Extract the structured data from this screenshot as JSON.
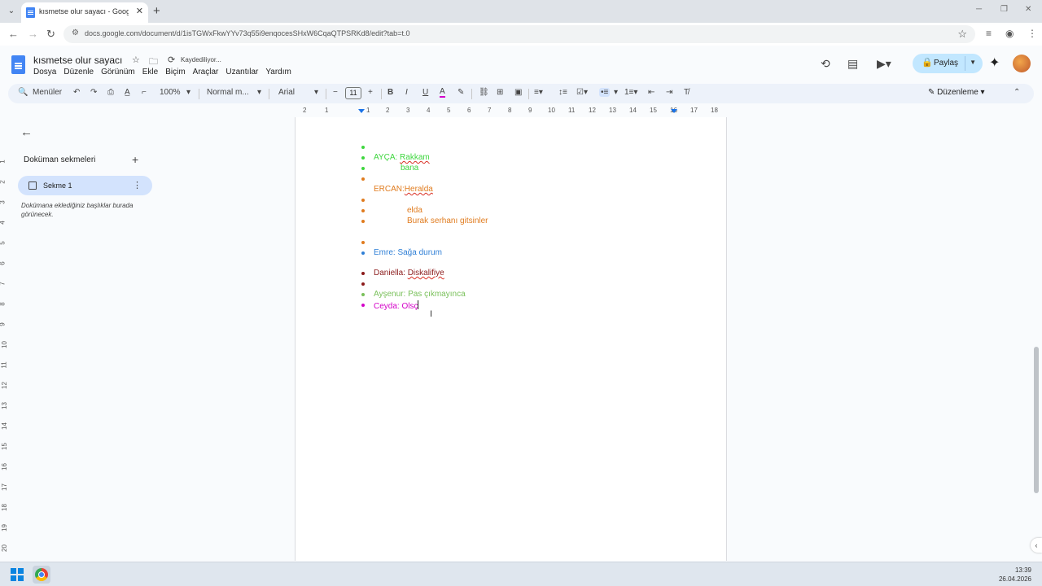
{
  "browser": {
    "tab_title": "kısmetse olur sayacı - Google D",
    "url": "docs.google.com/document/d/1isTGWxFkwYYv73q55i9enqocesSHxW6CqaQTPSRKd8/edit?tab=t.0"
  },
  "docs": {
    "title": "kısmetse olur sayacı",
    "save_status": "Kaydediliyor...",
    "menu": [
      "Dosya",
      "Düzenle",
      "Görünüm",
      "Ekle",
      "Biçim",
      "Araçlar",
      "Uzantılar",
      "Yardım"
    ],
    "share_label": "Paylaş",
    "share_color": "#c2e7ff"
  },
  "toolbar": {
    "menus_label": "Menüler",
    "zoom": "100%",
    "style": "Normal m...",
    "font": "Arial",
    "font_size": "11",
    "edit_mode": "Düzenleme"
  },
  "ruler": {
    "h": [
      "2",
      "1",
      "1",
      "2",
      "3",
      "4",
      "5",
      "6",
      "7",
      "8",
      "9",
      "10",
      "11",
      "12",
      "13",
      "14",
      "15",
      "16",
      "17",
      "18"
    ],
    "v": [
      "1",
      "2",
      "3",
      "4",
      "5",
      "6",
      "7",
      "8",
      "9",
      "10",
      "11",
      "12",
      "13",
      "14",
      "15",
      "16",
      "17",
      "18",
      "19",
      "20"
    ]
  },
  "left_panel": {
    "heading": "Doküman sekmeleri",
    "tab_label": "Sekme 1",
    "hint": "Dokümana eklediğiniz başlıklar burada görünecek."
  },
  "document": {
    "lines": [
      {
        "text": "",
        "color": "#3ed63e",
        "bullet": true
      },
      {
        "prefix": "AYÇA: ",
        "text": "Rakkam",
        "color": "#3ed63e",
        "bullet": true,
        "wavy": true
      },
      {
        "text": "bana",
        "color": "#3ed63e",
        "bullet": true,
        "indent": true
      },
      {
        "text": "",
        "color": "#e07b1e",
        "bullet": true
      },
      {
        "prefix": "ERCAN:",
        "text": "Heralda",
        "color": "#e07b1e",
        "bullet": false,
        "wavy": true
      },
      {
        "text": "",
        "color": "#e07b1e",
        "bullet": true
      },
      {
        "text": "elda",
        "color": "#e07b1e",
        "bullet": true,
        "indent2": true
      },
      {
        "text": "Burak serhanı gitsinler",
        "color": "#e07b1e",
        "bullet": true,
        "indent2": true
      },
      {
        "text": "",
        "color": "#e07b1e",
        "bullet": true
      },
      {
        "prefix": "Emre: ",
        "text": "Sağa durum",
        "color": "#2f7fd6",
        "bullet": true
      },
      {
        "prefix": "Daniella: ",
        "text": "Diskalifiye",
        "color": "#8b1a1a",
        "bullet": true,
        "wavy": true
      },
      {
        "text": "",
        "color": "#8b1a1a",
        "bullet": true
      },
      {
        "prefix": "Ayşenur: ",
        "text": "Pas çıkmayınca",
        "color": "#79c05a",
        "bullet": true
      },
      {
        "prefix": "Ceyda: ",
        "text": "Olsç",
        "color": "#d400c8",
        "bullet": true,
        "caret": true
      }
    ]
  },
  "taskbar": {
    "time": "13:39",
    "date": "26.04.2026"
  }
}
